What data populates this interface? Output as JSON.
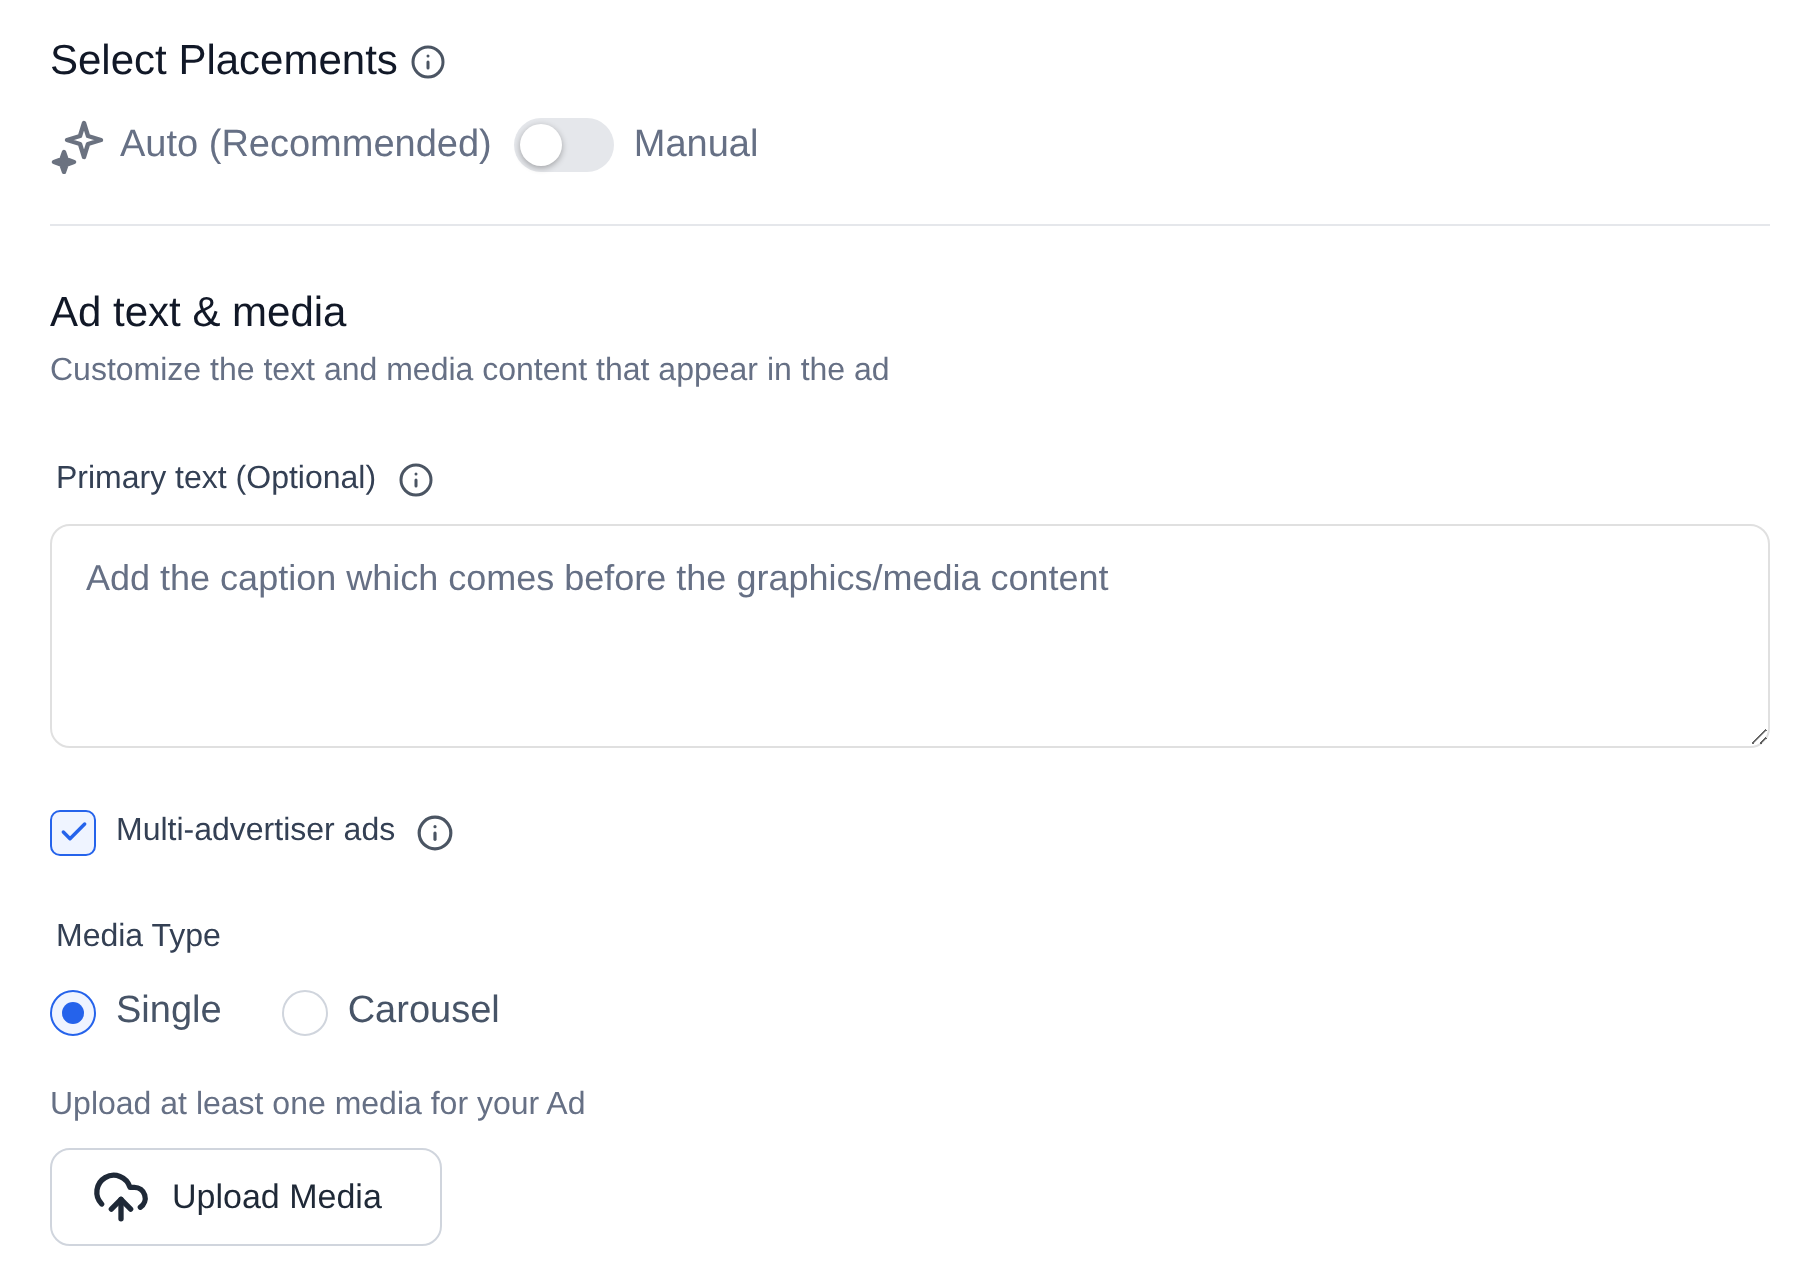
{
  "placements": {
    "title": "Select Placements",
    "auto_label": "Auto (Recommended)",
    "manual_label": "Manual",
    "manual_on": false
  },
  "ad_text_media": {
    "title": "Ad text & media",
    "subtitle": "Customize the text and media content that appear in the ad"
  },
  "primary_text": {
    "label": "Primary text (Optional)",
    "placeholder": "Add the caption which comes before the graphics/media content"
  },
  "multi_advertiser": {
    "label": "Multi-advertiser ads",
    "checked": true
  },
  "media_type": {
    "label": "Media Type",
    "options": [
      {
        "label": "Single",
        "selected": true
      },
      {
        "label": "Carousel",
        "selected": false
      }
    ]
  },
  "upload": {
    "hint": "Upload at least one media for your Ad",
    "button": "Upload Media"
  }
}
